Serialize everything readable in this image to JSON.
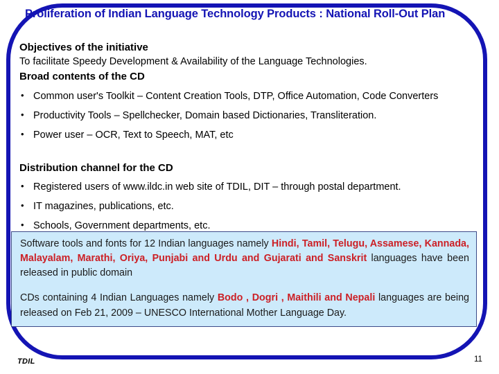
{
  "slide": {
    "title": "Proliferation of Indian Language Technology Products : National Roll-Out Plan",
    "frame_color": "#1414b4",
    "title_color": "#1414b4"
  },
  "objectives": {
    "heading": "Objectives of the initiative",
    "text": "To facilitate Speedy Development & Availability of the Language Technologies."
  },
  "broad_contents": {
    "heading": "Broad contents of the CD",
    "bullets": [
      "Common user's Toolkit – Content Creation Tools, DTP, Office Automation, Code Converters",
      "Productivity Tools – Spellchecker, Domain based Dictionaries, Transliteration.",
      "Power user – OCR, Text to Speech, MAT, etc"
    ]
  },
  "distribution": {
    "heading": "Distribution channel for the CD",
    "bullets": [
      "Registered users of www.ildc.in web site of TDIL, DIT – through postal department.",
      "IT magazines, publications, etc.",
      "Schools, Government departments, etc."
    ]
  },
  "highlight": {
    "background_color": "#cdeafb",
    "border_color": "#3b4a88",
    "accent_color": "#cc2026",
    "paragraph_1": {
      "lead": "Software tools and fonts for 12 Indian languages namely ",
      "languages": "Hindi, Tamil, Telugu, Assamese, Kannada, Malayalam, Marathi, Oriya, Punjabi and Urdu and Gujarati and Sanskrit",
      "tail": " languages have been released in public domain"
    },
    "paragraph_2": {
      "lead": "CDs containing 4 Indian Languages namely ",
      "languages": "Bodo , Dogri , Maithili and Nepali",
      "tail": " languages are being released on Feb 21, 2009 – UNESCO International Mother Language Day."
    }
  },
  "footer": {
    "logo": "TDIL",
    "page_number": "11"
  }
}
